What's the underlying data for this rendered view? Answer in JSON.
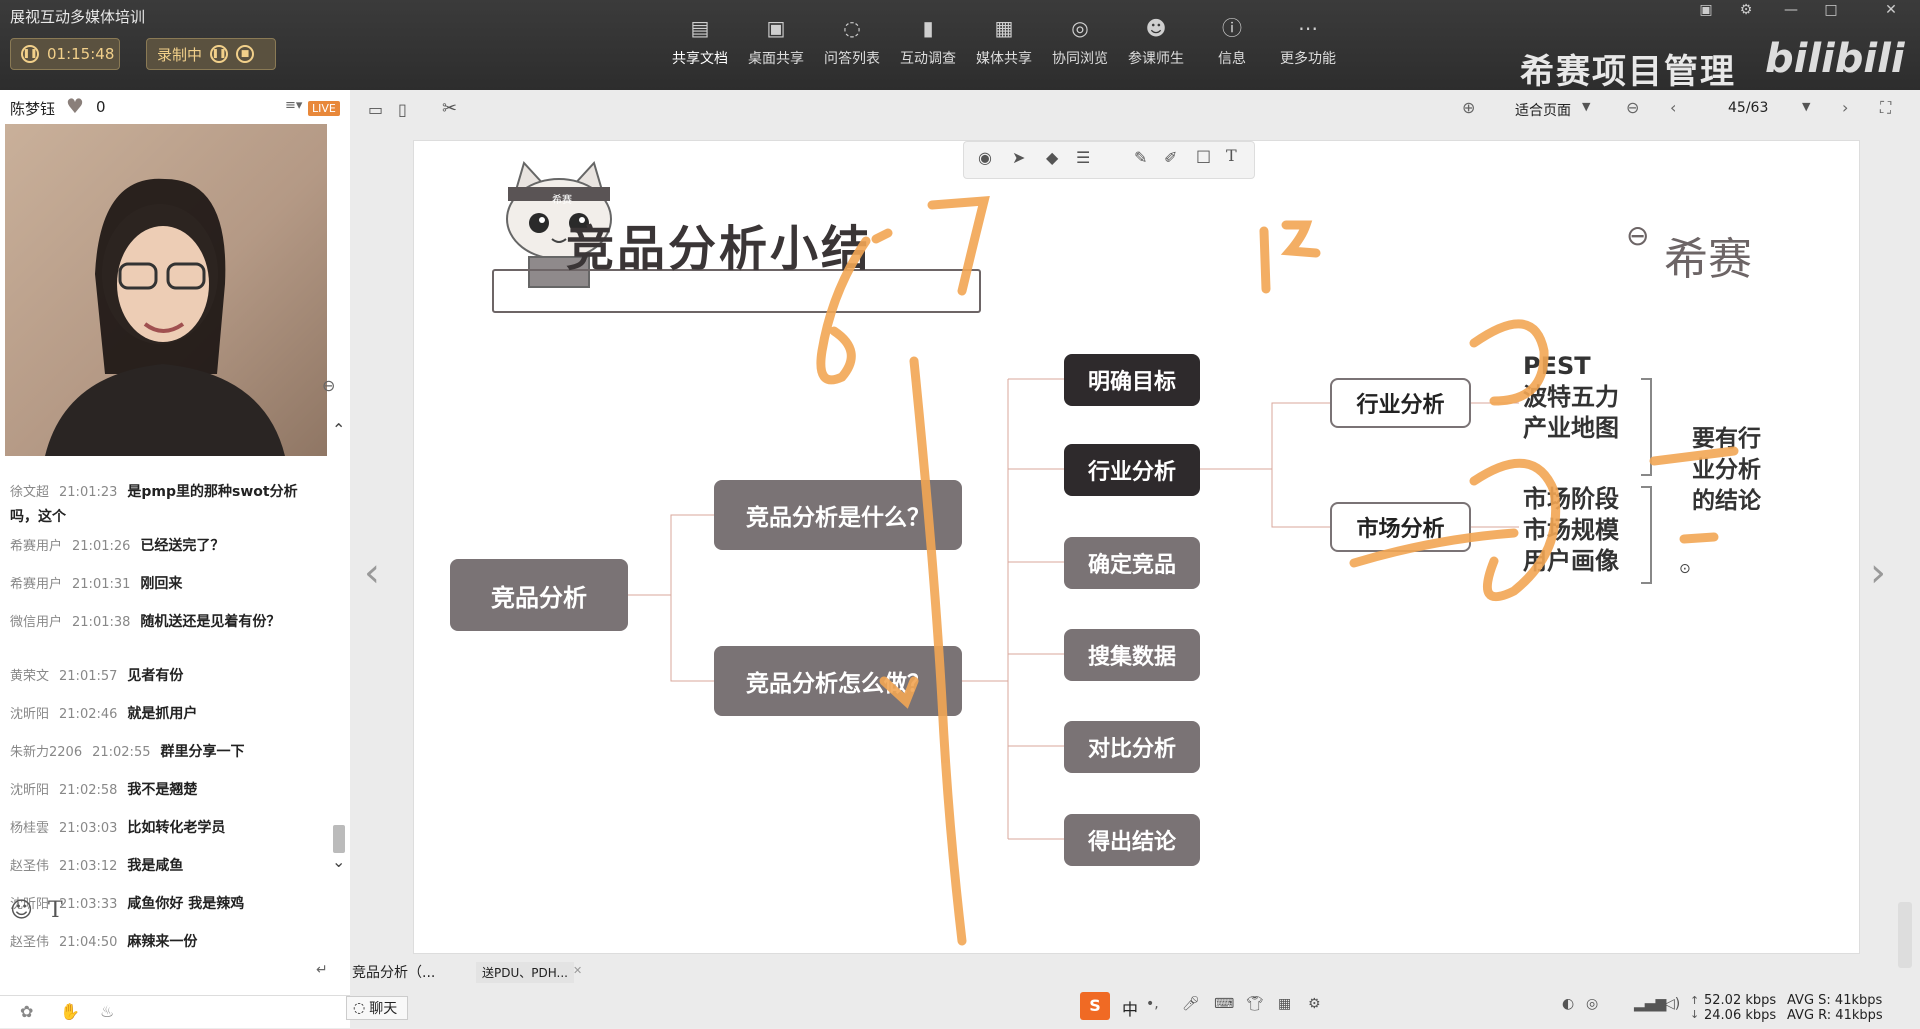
{
  "app": {
    "title": "展视互动多媒体培训",
    "timer": "01:15:48",
    "record_label": "录制中"
  },
  "toolbar": {
    "items": [
      {
        "label": "共享文档",
        "icon": "document-icon"
      },
      {
        "label": "桌面共享",
        "icon": "monitor-icon"
      },
      {
        "label": "问答列表",
        "icon": "chat-icon"
      },
      {
        "label": "互动调查",
        "icon": "bar-chart-icon"
      },
      {
        "label": "媒体共享",
        "icon": "film-icon"
      },
      {
        "label": "协同浏览",
        "icon": "compass-icon"
      },
      {
        "label": "参课师生",
        "icon": "users-icon"
      },
      {
        "label": "信息",
        "icon": "info-icon"
      },
      {
        "label": "更多功能",
        "icon": "more-icon"
      }
    ],
    "active_index": 0
  },
  "brand": {
    "name": "希赛项目管理",
    "logo_text": "bilibili"
  },
  "presenter": {
    "name": "陈梦钰",
    "likes": "0",
    "live_badge": "LIVE"
  },
  "chat": {
    "messages": [
      {
        "user": "徐文超",
        "time": "21:01:23",
        "text": "是pmp里的那种swot分析吗，这个"
      },
      {
        "user": "希赛用户",
        "time": "21:01:26",
        "text": "已经送完了？"
      },
      {
        "user": "希赛用户",
        "time": "21:01:31",
        "text": "刚回来"
      },
      {
        "user": "微信用户",
        "time": "21:01:38",
        "text": "随机送还是见着有份？"
      },
      {
        "user": "黄荣文",
        "time": "21:01:57",
        "text": "见者有份"
      },
      {
        "user": "沈昕阳",
        "time": "21:02:46",
        "text": "就是抓用户"
      },
      {
        "user": "朱新力2206",
        "time": "21:02:55",
        "text": "群里分享一下"
      },
      {
        "user": "沈昕阳",
        "time": "21:02:58",
        "text": "我不是翘楚"
      },
      {
        "user": "杨桂雲",
        "time": "21:03:03",
        "text": "比如转化老学员"
      },
      {
        "user": "赵圣伟",
        "time": "21:03:12",
        "text": "我是咸鱼"
      },
      {
        "user": "沈昕阳",
        "time": "21:03:33",
        "text": "咸鱼你好  我是辣鸡"
      },
      {
        "user": "赵圣伟",
        "time": "21:04:50",
        "text": "麻辣来一份"
      }
    ],
    "tab_label": "聊天"
  },
  "viewer": {
    "fit_label": "适合页面",
    "page_indicator": "45/63"
  },
  "slide": {
    "title": "竞品分析小结",
    "logo_text": "希赛",
    "mascot_badge": "希赛",
    "root": "竞品分析",
    "branch1": "竞品分析是什么？",
    "branch2": "竞品分析怎么做？",
    "steps": [
      "明确目标",
      "行业分析",
      "确定竞品",
      "搜集数据",
      "对比分析",
      "得出结论"
    ],
    "industry": "行业分析",
    "market": "市场分析",
    "industry_items": [
      "PEST",
      "波特五力",
      "产业地图"
    ],
    "market_items": [
      "市场阶段",
      "市场规模",
      "用户画像"
    ],
    "conclusion": [
      "要有行",
      "业分析",
      "的结论"
    ],
    "handwriting": [
      "6",
      "7",
      "1-2"
    ]
  },
  "taskbar": {
    "tabs": [
      "竞品分析（...",
      "送PDU、PDH..."
    ],
    "ime": "中",
    "upload": "52.02 kbps",
    "download": "24.06 kbps",
    "avg_s": "AVG S: 41kbps",
    "avg_r": "AVG R: 41kbps"
  },
  "colors": {
    "annotation": "#f2a654",
    "node_dark": "#2e2a2c",
    "node_mid": "#7a7375",
    "record_gold": "#f2d08a"
  }
}
